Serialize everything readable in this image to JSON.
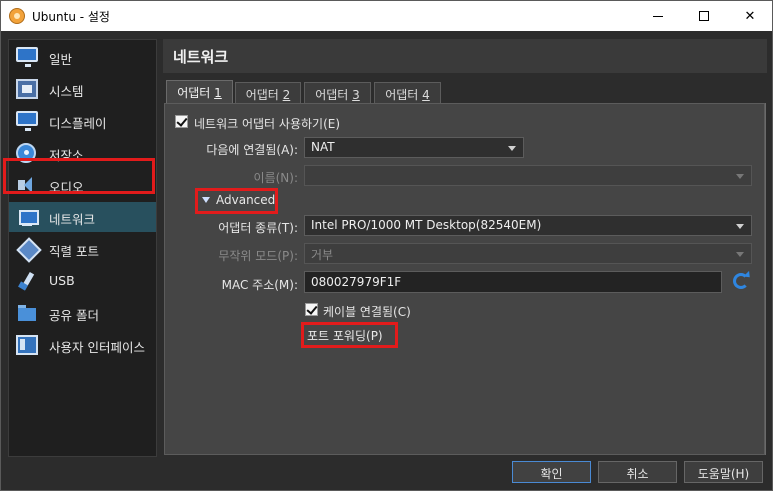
{
  "window": {
    "title": "Ubuntu - 설정",
    "controls": {
      "minimize": "",
      "maximize": "",
      "close": "✕"
    }
  },
  "sidebar": {
    "items": [
      {
        "label": "일반",
        "icon": "general-monitor-icon"
      },
      {
        "label": "시스템",
        "icon": "system-chip-icon"
      },
      {
        "label": "디스플레이",
        "icon": "display-monitor-icon"
      },
      {
        "label": "저장소",
        "icon": "storage-disk-icon"
      },
      {
        "label": "오디오",
        "icon": "audio-speaker-icon"
      },
      {
        "label": "네트워크",
        "icon": "network-icon",
        "selected": true
      },
      {
        "label": "직렬 포트",
        "icon": "serial-port-icon"
      },
      {
        "label": "USB",
        "icon": "usb-icon"
      },
      {
        "label": "공유 폴더",
        "icon": "shared-folder-icon"
      },
      {
        "label": "사용자 인터페이스",
        "icon": "user-interface-icon"
      }
    ]
  },
  "main": {
    "header": "네트워크",
    "tabs": [
      {
        "label": "어댑터 ",
        "num": "1",
        "active": true
      },
      {
        "label": "어댑터 ",
        "num": "2"
      },
      {
        "label": "어댑터 ",
        "num": "3"
      },
      {
        "label": "어댑터 ",
        "num": "4"
      }
    ],
    "enable_adapter": {
      "label": "네트워크 어댑터 사용하기(E)",
      "checked": true
    },
    "attached_to": {
      "label": "다음에 연결됨(A):",
      "value": "NAT"
    },
    "name": {
      "label": "이름(N):",
      "value": ""
    },
    "advanced": {
      "label": "Advanced",
      "expanded": true
    },
    "adapter_type": {
      "label": "어댑터 종류(T):",
      "value": "Intel PRO/1000 MT Desktop(82540EM)"
    },
    "promiscuous": {
      "label": "무작위 모드(P):",
      "value": "거부"
    },
    "mac": {
      "label": "MAC 주소(M):",
      "value": "080027979F1F"
    },
    "cable_connected": {
      "label": "케이블 연결됨(C)",
      "checked": true
    },
    "port_forwarding": {
      "label": "포트 포워딩(P)"
    }
  },
  "buttons": {
    "ok": "확인",
    "cancel": "취소",
    "help": "도움말(H)"
  },
  "colors": {
    "highlight_box": "#e21b1b",
    "selected_item": "#28505e",
    "accent": "#2f86e0"
  }
}
